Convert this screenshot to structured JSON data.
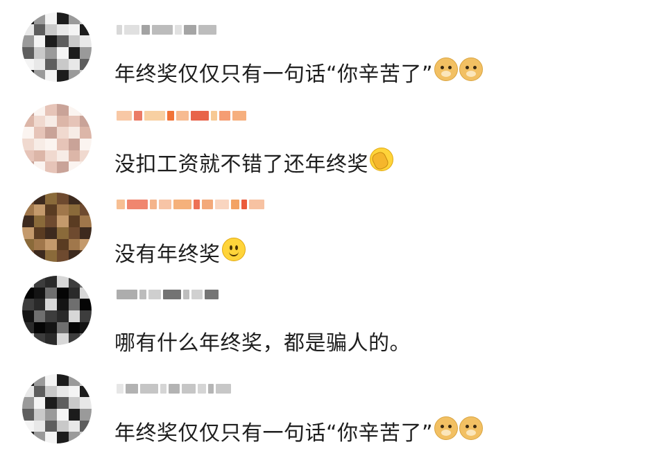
{
  "comments": [
    {
      "text": "年终奖仅仅只有一句话“你辛苦了”",
      "emojis": [
        "doge-icon",
        "doge-icon"
      ],
      "avatar_palette": [
        "#1c1c1c",
        "#e8e8e8",
        "#9a9a9a",
        "#5e5e5e",
        "#f4f4f4",
        "#c9c9c9"
      ],
      "username_palette": [
        "#b8b8b8",
        "#d2d2d2",
        "#8e8e8e"
      ]
    },
    {
      "text": "没扣工资就不错了还年终奖",
      "emojis": [
        "facepalm-icon"
      ],
      "avatar_palette": [
        "#f0d9cf",
        "#e6c4b8",
        "#f7ece6",
        "#c9a398",
        "#dcb6a8",
        "#fbf4f0"
      ],
      "username_palette": [
        "#f06a2a",
        "#f39a5b",
        "#e23d1d",
        "#f6c58c"
      ]
    },
    {
      "text": "没有年终奖",
      "emojis": [
        "smile-icon"
      ],
      "avatar_palette": [
        "#6e4a2f",
        "#a0774b",
        "#3d2a1e",
        "#c49a6c",
        "#8a6a3a",
        "#5a3c22"
      ],
      "username_palette": [
        "#f2a270",
        "#f6c0a0",
        "#f08a3a",
        "#e94d2b"
      ]
    },
    {
      "text": "哪有什么年终奖，都是骗人的。",
      "emojis": [],
      "avatar_palette": [
        "#141414",
        "#2a2a2a",
        "#6f6f6f",
        "#d7d7d7",
        "#050505",
        "#3d3d3d"
      ],
      "username_palette": [
        "#6a6a6a",
        "#9c9c9c",
        "#c4c4c4"
      ]
    },
    {
      "text": "年终奖仅仅只有一句话“你辛苦了”",
      "emojis": [
        "doge-icon",
        "doge-icon"
      ],
      "avatar_palette": [
        "#1c1c1c",
        "#e8e8e8",
        "#9a9a9a",
        "#5e5e5e",
        "#f4f4f4",
        "#c9c9c9"
      ],
      "username_palette": [
        "#b8b8b8",
        "#d2d2d2",
        "#8e8e8e"
      ]
    }
  ]
}
